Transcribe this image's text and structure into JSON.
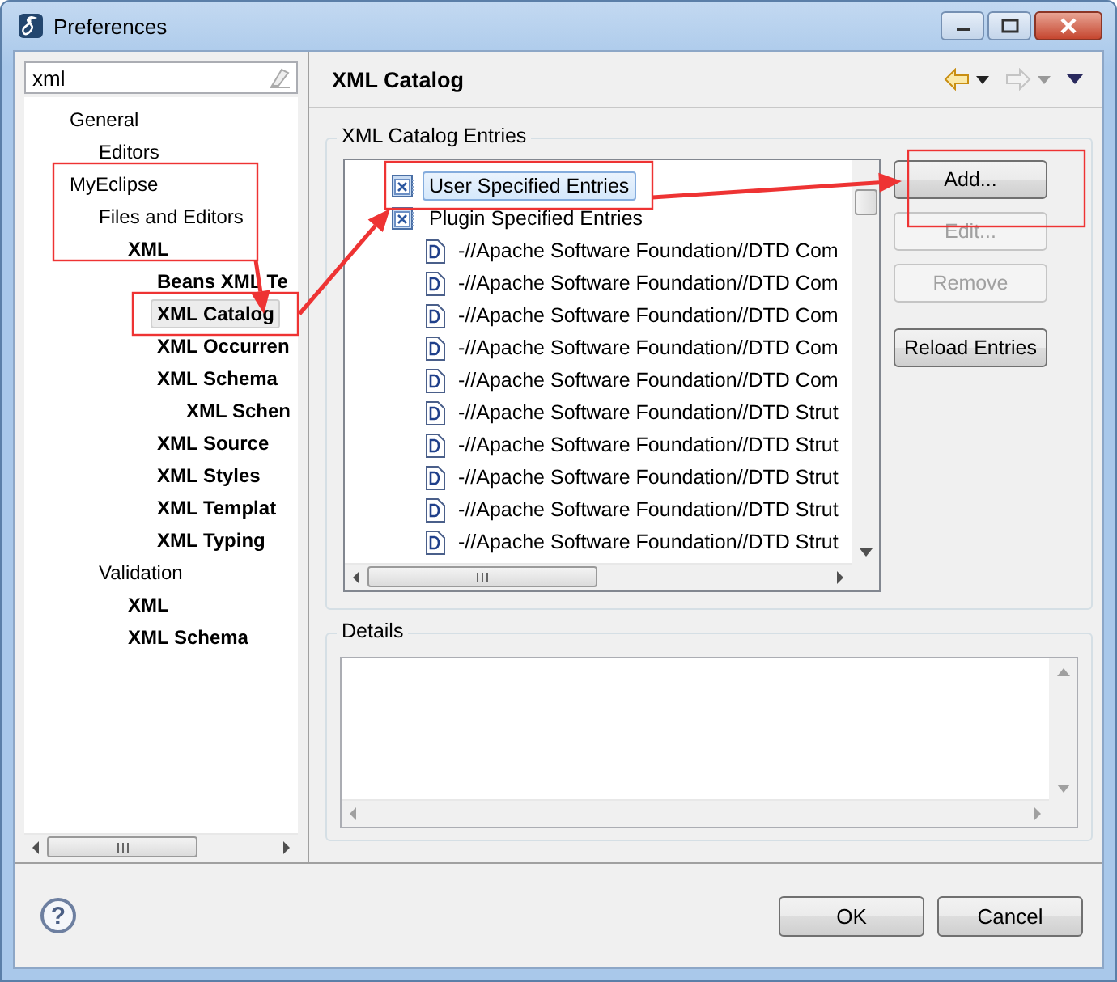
{
  "window": {
    "title": "Preferences"
  },
  "filter": {
    "value": "xml"
  },
  "tree": [
    {
      "label": "General",
      "matched": false,
      "selected": false,
      "children": [
        {
          "label": "Editors",
          "matched": false,
          "selected": false
        }
      ]
    },
    {
      "label": "MyEclipse",
      "matched": false,
      "selected": false,
      "children": [
        {
          "label": "Files and Editors",
          "matched": false,
          "selected": false,
          "children": [
            {
              "label": "XML",
              "matched": true,
              "selected": false,
              "children": [
                {
                  "label": "Beans XML Te",
                  "matched": true,
                  "selected": false
                },
                {
                  "label": "XML Catalog",
                  "matched": true,
                  "selected": true
                },
                {
                  "label": "XML Occurren",
                  "matched": true,
                  "selected": false
                },
                {
                  "label": "XML Schema",
                  "matched": true,
                  "selected": false,
                  "children": [
                    {
                      "label": "XML Schen",
                      "matched": true,
                      "selected": false
                    }
                  ]
                },
                {
                  "label": "XML Source",
                  "matched": true,
                  "selected": false
                },
                {
                  "label": "XML Styles",
                  "matched": true,
                  "selected": false
                },
                {
                  "label": "XML Templat",
                  "matched": true,
                  "selected": false
                },
                {
                  "label": "XML Typing",
                  "matched": true,
                  "selected": false
                }
              ]
            }
          ]
        },
        {
          "label": "Validation",
          "matched": false,
          "selected": false,
          "children": [
            {
              "label": "XML",
              "matched": true,
              "selected": false
            },
            {
              "label": "XML Schema",
              "matched": true,
              "selected": false
            }
          ]
        }
      ]
    }
  ],
  "page": {
    "title": "XML Catalog",
    "entries_group": {
      "label": "XML Catalog Entries",
      "entries": [
        {
          "label": "User Specified Entries",
          "kind": "catalog",
          "selected": true
        },
        {
          "label": "Plugin Specified Entries",
          "kind": "catalog",
          "selected": false,
          "children": [
            {
              "label": "-//Apache Software Foundation//DTD Com",
              "kind": "document",
              "selected": false
            },
            {
              "label": "-//Apache Software Foundation//DTD Com",
              "kind": "document",
              "selected": false
            },
            {
              "label": "-//Apache Software Foundation//DTD Com",
              "kind": "document",
              "selected": false
            },
            {
              "label": "-//Apache Software Foundation//DTD Com",
              "kind": "document",
              "selected": false
            },
            {
              "label": "-//Apache Software Foundation//DTD Com",
              "kind": "document",
              "selected": false
            },
            {
              "label": "-//Apache Software Foundation//DTD Strut",
              "kind": "document",
              "selected": false
            },
            {
              "label": "-//Apache Software Foundation//DTD Strut",
              "kind": "document",
              "selected": false
            },
            {
              "label": "-//Apache Software Foundation//DTD Strut",
              "kind": "document",
              "selected": false
            },
            {
              "label": "-//Apache Software Foundation//DTD Strut",
              "kind": "document",
              "selected": false
            },
            {
              "label": "-//Apache Software Foundation//DTD Strut",
              "kind": "document",
              "selected": false
            }
          ]
        }
      ],
      "buttons": [
        {
          "label": "Add...",
          "disabled": false
        },
        {
          "label": "Edit...",
          "disabled": true
        },
        {
          "label": "Remove",
          "disabled": true
        },
        {
          "label": "Reload Entries",
          "disabled": false
        }
      ]
    },
    "details_group": {
      "label": "Details"
    }
  },
  "footer": {
    "help": "?",
    "buttons": [
      "OK",
      "Cancel"
    ]
  },
  "annotation_marks": true
}
